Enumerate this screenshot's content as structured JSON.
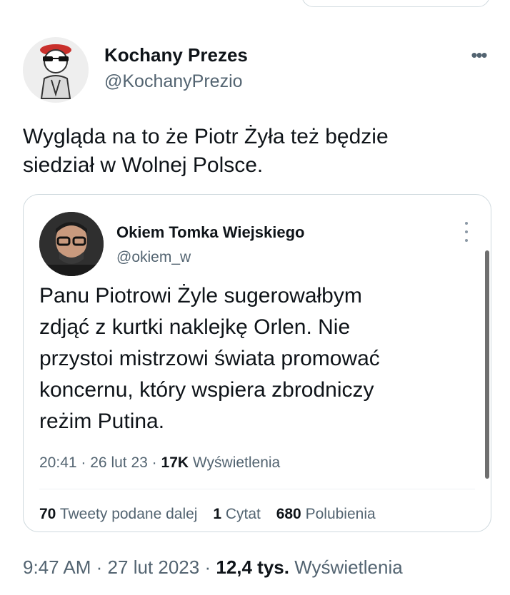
{
  "tweet": {
    "author_name": "Kochany Prezes",
    "author_handle": "@KochanyPrezio",
    "more_icon": "more-horizontal-icon",
    "text": "Wygląda na to że Piotr Żyła też będzie\nsiedział w Wolnej Polsce.",
    "time": "9:47 AM",
    "date": "27 lut 2023",
    "views_count": "12,4 tys.",
    "views_label": "Wyświetlenia",
    "separator": "·"
  },
  "quote": {
    "author_name": "Okiem Tomka Wiejskiego",
    "author_handle": "@okiem_w",
    "more_icon": "more-vertical-icon",
    "text": "Panu Piotrowi Żyle sugerowałbym\nzdjąć z kurtki naklejkę Orlen. Nie\nprzystoi mistrzowi świata promować\nkoncernu, który wspiera zbrodniczy\nreżim Putina.",
    "time": "20:41",
    "date": "26 lut 23",
    "views_count": "17K",
    "views_label": "Wyświetlenia",
    "retweets_count": "70",
    "retweets_label": "Tweety podane dalej",
    "quotes_count": "1",
    "quotes_label": "Cytat",
    "likes_count": "680",
    "likes_label": "Polubienia"
  },
  "colors": {
    "text_primary": "#0f1419",
    "text_secondary": "#536471",
    "border": "#cfd9de"
  }
}
